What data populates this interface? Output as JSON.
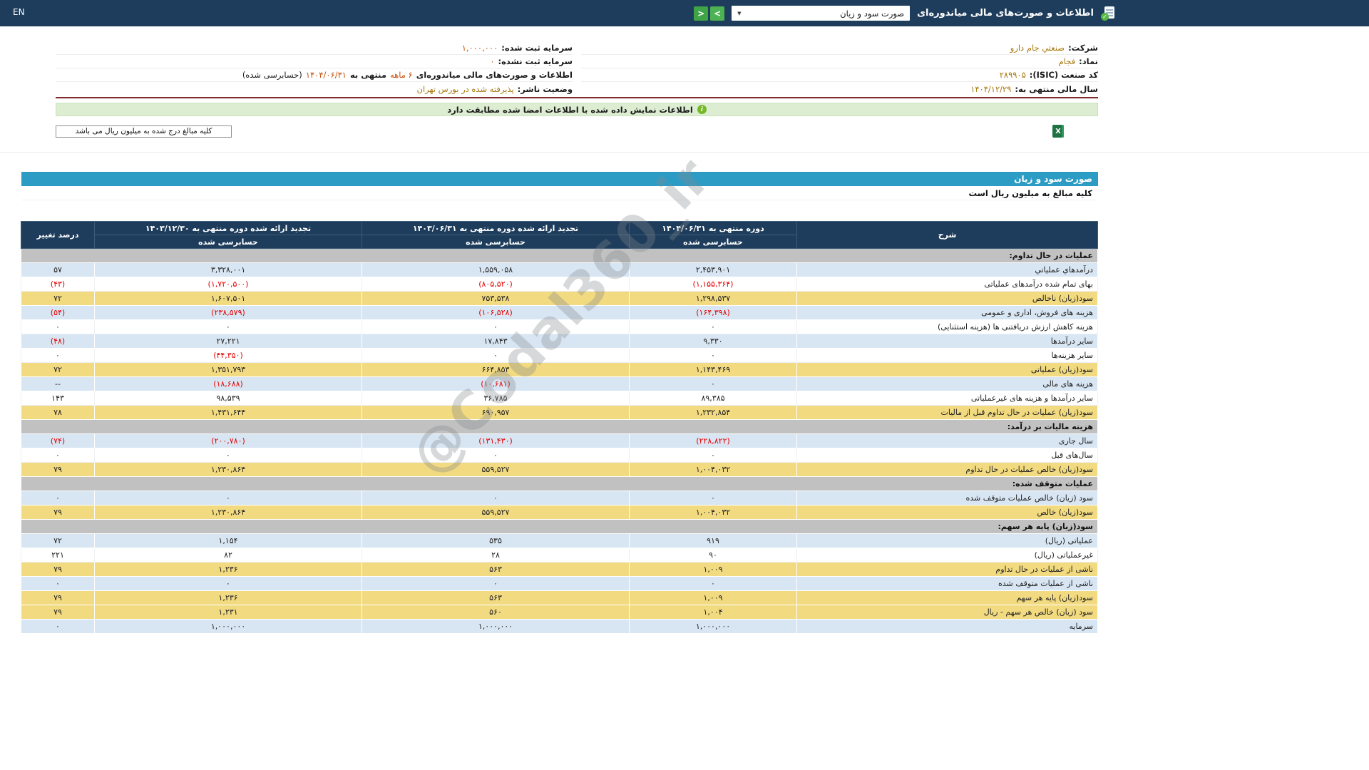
{
  "icons": {
    "info": "i",
    "check": "✓",
    "caret": "▼",
    "excel": "X"
  },
  "topbar": {
    "title": "اطلاعات و صورت‌های مالی میاندوره‌ای",
    "statement_select_value": "صورت سود و زیان",
    "next_button": ">",
    "prev_button": "<",
    "lang_link": "EN"
  },
  "company_info": {
    "company_label": "شرکت:",
    "company_value": "صنعتي جام دارو",
    "symbol_label": "نماد:",
    "symbol_value": "فجام",
    "isic_label": "کد صنعت (ISIC):",
    "isic_value": "۲۸۹۹۰۵",
    "fiscal_year_label": "سال مالی منتهی به:",
    "fiscal_year_value": "۱۴۰۴/۱۲/۲۹",
    "registered_capital_label": "سرمایه ثبت شده:",
    "registered_capital_value": "۱,۰۰۰,۰۰۰",
    "unregistered_capital_label": "سرمایه ثبت نشده:",
    "unregistered_capital_value": "۰",
    "period": {
      "prefix": "اطلاعات و صورت‌های مالی میاندوره‌ای",
      "months": "۶ ماهه",
      "mid": "منتهی به",
      "date": "۱۴۰۴/۰۶/۳۱",
      "suffix": "(حسابرسی شده)"
    },
    "issuer_status_label": "وضعیت ناشر:",
    "issuer_status_value": "پذیرفته شده در بورس تهران"
  },
  "notices": {
    "signed_match": "اطلاعات نمایش داده شده با اطلاعات امضا شده مطابقت دارد",
    "million_note": "کلیه مبالغ درج شده به میلیون ریال می باشد"
  },
  "statement": {
    "title": "صورت سود و زیان",
    "units_note": "کلیه مبالغ به میلیون ریال است",
    "watermark": "@Codal360_ir",
    "columns": {
      "description": "شرح",
      "current_period": "دوره منتهی به ۱۴۰۴/۰۶/۳۱",
      "restated_prior_6m": "تجدید ارائه شده دوره منتهی به ۱۴۰۳/۰۶/۳۱",
      "restated_prior_year": "تجدید ارائه شده دوره منتهی به ۱۴۰۳/۱۲/۳۰",
      "audited": "حسابرسی شده",
      "change_percent": "درصد تغییر"
    },
    "rows": [
      {
        "style": "section",
        "label": "عملیات در حال تداوم:",
        "values": [
          "",
          "",
          "",
          ""
        ]
      },
      {
        "style": "blue",
        "label": "درآمدهاي عملياتي",
        "values": [
          "۲,۴۵۳,۹۰۱",
          "۱,۵۵۹,۰۵۸",
          "۳,۳۲۸,۰۰۱",
          "۵۷"
        ]
      },
      {
        "style": "white",
        "label": "بهای تمام شده درآمدهای عملیاتی",
        "values": [
          "(۱,۱۵۵,۳۶۴)",
          "(۸۰۵,۵۲۰)",
          "(۱,۷۲۰,۵۰۰)",
          "(۴۳)"
        ]
      },
      {
        "style": "yellow",
        "label": "سود(زیان) ناخالص",
        "values": [
          "۱,۲۹۸,۵۳۷",
          "۷۵۳,۵۳۸",
          "۱,۶۰۷,۵۰۱",
          "۷۲"
        ]
      },
      {
        "style": "blue",
        "label": "هزینه های فروش، اداری و عمومی",
        "values": [
          "(۱۶۴,۳۹۸)",
          "(۱۰۶,۵۲۸)",
          "(۲۳۸,۵۷۹)",
          "(۵۴)"
        ]
      },
      {
        "style": "white",
        "label": "هزینه کاهش ارزش دریافتنی ها (هزینه استثنایی)",
        "values": [
          "۰",
          "۰",
          "۰",
          "۰"
        ]
      },
      {
        "style": "blue",
        "label": "سایر درآمدها",
        "values": [
          "۹,۳۳۰",
          "۱۷,۸۴۳",
          "۲۷,۲۲۱",
          "(۴۸)"
        ]
      },
      {
        "style": "white",
        "label": "سایر هزینه‌ها",
        "values": [
          "۰",
          "۰",
          "(۴۴,۳۵۰)",
          "۰"
        ]
      },
      {
        "style": "yellow",
        "label": "سود(زیان) عملیاتی",
        "values": [
          "۱,۱۴۳,۴۶۹",
          "۶۶۴,۸۵۳",
          "۱,۳۵۱,۷۹۳",
          "۷۲"
        ]
      },
      {
        "style": "blue",
        "label": "هزینه های مالی",
        "values": [
          "۰",
          "(۱۰,۶۸۱)",
          "(۱۸,۶۸۸)",
          "--"
        ]
      },
      {
        "style": "white",
        "label": "سایر درآمدها و هزینه های غیرعملیاتی",
        "values": [
          "۸۹,۳۸۵",
          "۳۶,۷۸۵",
          "۹۸,۵۳۹",
          "۱۴۳"
        ]
      },
      {
        "style": "yellow",
        "label": "سود(زیان) عملیات در حال تداوم قبل از مالیات",
        "values": [
          "۱,۲۳۲,۸۵۴",
          "۶۹۰,۹۵۷",
          "۱,۴۳۱,۶۴۴",
          "۷۸"
        ]
      },
      {
        "style": "section",
        "label": "هزینه مالیات بر درآمد:",
        "values": [
          "",
          "",
          "",
          ""
        ]
      },
      {
        "style": "blue",
        "label": "سال جاری",
        "values": [
          "(۲۲۸,۸۲۲)",
          "(۱۳۱,۴۳۰)",
          "(۲۰۰,۷۸۰)",
          "(۷۴)"
        ]
      },
      {
        "style": "white",
        "label": "سال‌های قبل",
        "values": [
          "۰",
          "۰",
          "۰",
          "۰"
        ]
      },
      {
        "style": "yellow",
        "label": "سود(زیان) خالص عملیات در حال تداوم",
        "values": [
          "۱,۰۰۴,۰۳۲",
          "۵۵۹,۵۲۷",
          "۱,۲۳۰,۸۶۴",
          "۷۹"
        ]
      },
      {
        "style": "section",
        "label": "عملیات متوقف شده:",
        "values": [
          "",
          "",
          "",
          ""
        ]
      },
      {
        "style": "blue",
        "label": "سود (زیان) خالص عملیات متوقف شده",
        "values": [
          "۰",
          "۰",
          "۰",
          "۰"
        ]
      },
      {
        "style": "yellow",
        "label": "سود(زیان) خالص",
        "values": [
          "۱,۰۰۴,۰۳۲",
          "۵۵۹,۵۲۷",
          "۱,۲۳۰,۸۶۴",
          "۷۹"
        ]
      },
      {
        "style": "section",
        "label": "سود(زیان) پایه هر سهم:",
        "values": [
          "",
          "",
          "",
          ""
        ]
      },
      {
        "style": "blue",
        "label": "عملیاتی (ریال)",
        "values": [
          "۹۱۹",
          "۵۳۵",
          "۱,۱۵۴",
          "۷۲"
        ]
      },
      {
        "style": "white",
        "label": "غیرعملیاتی (ریال)",
        "values": [
          "۹۰",
          "۲۸",
          "۸۲",
          "۲۲۱"
        ]
      },
      {
        "style": "yellow",
        "label": "ناشی از عملیات در حال تداوم",
        "values": [
          "۱,۰۰۹",
          "۵۶۳",
          "۱,۲۳۶",
          "۷۹"
        ]
      },
      {
        "style": "blue",
        "label": "ناشی از عملیات متوقف شده",
        "values": [
          "۰",
          "۰",
          "۰",
          "۰"
        ]
      },
      {
        "style": "yellow",
        "label": "سود(زیان) پایه هر سهم",
        "values": [
          "۱,۰۰۹",
          "۵۶۳",
          "۱,۲۳۶",
          "۷۹"
        ]
      },
      {
        "style": "yellow",
        "label": "سود (زیان) خالص هر سهم - ریال",
        "values": [
          "۱,۰۰۴",
          "۵۶۰",
          "۱,۲۳۱",
          "۷۹"
        ]
      },
      {
        "style": "blue",
        "label": "سرمایه",
        "values": [
          "۱,۰۰۰,۰۰۰",
          "۱,۰۰۰,۰۰۰",
          "۱,۰۰۰,۰۰۰",
          "۰"
        ]
      }
    ]
  },
  "colors": {
    "navy": "#1E3D5C",
    "title_blue": "#2D9CC5",
    "row_blue": "#D8E6F3",
    "row_yellow": "#F2DA80",
    "row_section": "#C1C1C1",
    "negative_red": "#E60000",
    "value_amber": "#A8780E",
    "value_orange": "#C8500A",
    "banner_green": "#DCEDD2"
  }
}
